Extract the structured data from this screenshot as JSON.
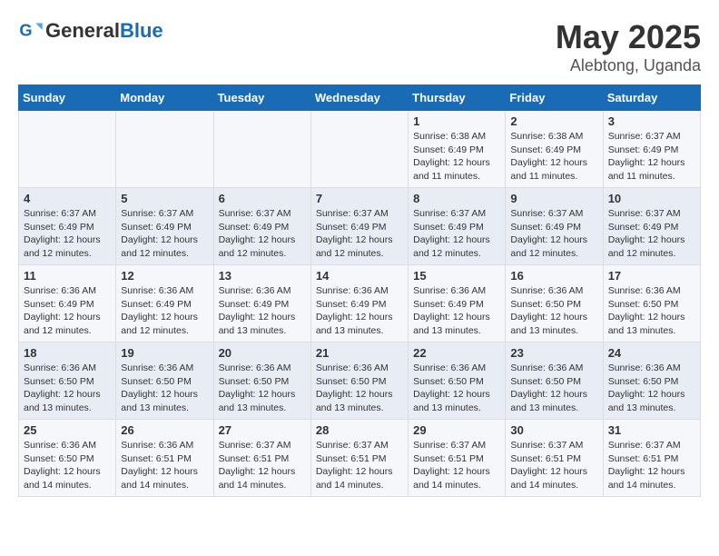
{
  "header": {
    "logo": {
      "general": "General",
      "blue": "Blue"
    },
    "month": "May 2025",
    "location": "Alebtong, Uganda"
  },
  "weekdays": [
    "Sunday",
    "Monday",
    "Tuesday",
    "Wednesday",
    "Thursday",
    "Friday",
    "Saturday"
  ],
  "weeks": [
    [
      {
        "day": "",
        "info": ""
      },
      {
        "day": "",
        "info": ""
      },
      {
        "day": "",
        "info": ""
      },
      {
        "day": "",
        "info": ""
      },
      {
        "day": "1",
        "info": "Sunrise: 6:38 AM\nSunset: 6:49 PM\nDaylight: 12 hours\nand 11 minutes."
      },
      {
        "day": "2",
        "info": "Sunrise: 6:38 AM\nSunset: 6:49 PM\nDaylight: 12 hours\nand 11 minutes."
      },
      {
        "day": "3",
        "info": "Sunrise: 6:37 AM\nSunset: 6:49 PM\nDaylight: 12 hours\nand 11 minutes."
      }
    ],
    [
      {
        "day": "4",
        "info": "Sunrise: 6:37 AM\nSunset: 6:49 PM\nDaylight: 12 hours\nand 12 minutes."
      },
      {
        "day": "5",
        "info": "Sunrise: 6:37 AM\nSunset: 6:49 PM\nDaylight: 12 hours\nand 12 minutes."
      },
      {
        "day": "6",
        "info": "Sunrise: 6:37 AM\nSunset: 6:49 PM\nDaylight: 12 hours\nand 12 minutes."
      },
      {
        "day": "7",
        "info": "Sunrise: 6:37 AM\nSunset: 6:49 PM\nDaylight: 12 hours\nand 12 minutes."
      },
      {
        "day": "8",
        "info": "Sunrise: 6:37 AM\nSunset: 6:49 PM\nDaylight: 12 hours\nand 12 minutes."
      },
      {
        "day": "9",
        "info": "Sunrise: 6:37 AM\nSunset: 6:49 PM\nDaylight: 12 hours\nand 12 minutes."
      },
      {
        "day": "10",
        "info": "Sunrise: 6:37 AM\nSunset: 6:49 PM\nDaylight: 12 hours\nand 12 minutes."
      }
    ],
    [
      {
        "day": "11",
        "info": "Sunrise: 6:36 AM\nSunset: 6:49 PM\nDaylight: 12 hours\nand 12 minutes."
      },
      {
        "day": "12",
        "info": "Sunrise: 6:36 AM\nSunset: 6:49 PM\nDaylight: 12 hours\nand 12 minutes."
      },
      {
        "day": "13",
        "info": "Sunrise: 6:36 AM\nSunset: 6:49 PM\nDaylight: 12 hours\nand 13 minutes."
      },
      {
        "day": "14",
        "info": "Sunrise: 6:36 AM\nSunset: 6:49 PM\nDaylight: 12 hours\nand 13 minutes."
      },
      {
        "day": "15",
        "info": "Sunrise: 6:36 AM\nSunset: 6:49 PM\nDaylight: 12 hours\nand 13 minutes."
      },
      {
        "day": "16",
        "info": "Sunrise: 6:36 AM\nSunset: 6:50 PM\nDaylight: 12 hours\nand 13 minutes."
      },
      {
        "day": "17",
        "info": "Sunrise: 6:36 AM\nSunset: 6:50 PM\nDaylight: 12 hours\nand 13 minutes."
      }
    ],
    [
      {
        "day": "18",
        "info": "Sunrise: 6:36 AM\nSunset: 6:50 PM\nDaylight: 12 hours\nand 13 minutes."
      },
      {
        "day": "19",
        "info": "Sunrise: 6:36 AM\nSunset: 6:50 PM\nDaylight: 12 hours\nand 13 minutes."
      },
      {
        "day": "20",
        "info": "Sunrise: 6:36 AM\nSunset: 6:50 PM\nDaylight: 12 hours\nand 13 minutes."
      },
      {
        "day": "21",
        "info": "Sunrise: 6:36 AM\nSunset: 6:50 PM\nDaylight: 12 hours\nand 13 minutes."
      },
      {
        "day": "22",
        "info": "Sunrise: 6:36 AM\nSunset: 6:50 PM\nDaylight: 12 hours\nand 13 minutes."
      },
      {
        "day": "23",
        "info": "Sunrise: 6:36 AM\nSunset: 6:50 PM\nDaylight: 12 hours\nand 13 minutes."
      },
      {
        "day": "24",
        "info": "Sunrise: 6:36 AM\nSunset: 6:50 PM\nDaylight: 12 hours\nand 13 minutes."
      }
    ],
    [
      {
        "day": "25",
        "info": "Sunrise: 6:36 AM\nSunset: 6:50 PM\nDaylight: 12 hours\nand 14 minutes."
      },
      {
        "day": "26",
        "info": "Sunrise: 6:36 AM\nSunset: 6:51 PM\nDaylight: 12 hours\nand 14 minutes."
      },
      {
        "day": "27",
        "info": "Sunrise: 6:37 AM\nSunset: 6:51 PM\nDaylight: 12 hours\nand 14 minutes."
      },
      {
        "day": "28",
        "info": "Sunrise: 6:37 AM\nSunset: 6:51 PM\nDaylight: 12 hours\nand 14 minutes."
      },
      {
        "day": "29",
        "info": "Sunrise: 6:37 AM\nSunset: 6:51 PM\nDaylight: 12 hours\nand 14 minutes."
      },
      {
        "day": "30",
        "info": "Sunrise: 6:37 AM\nSunset: 6:51 PM\nDaylight: 12 hours\nand 14 minutes."
      },
      {
        "day": "31",
        "info": "Sunrise: 6:37 AM\nSunset: 6:51 PM\nDaylight: 12 hours\nand 14 minutes."
      }
    ]
  ]
}
